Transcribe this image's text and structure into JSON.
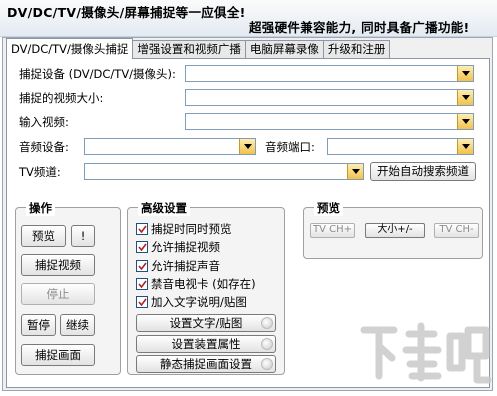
{
  "banner": {
    "line1": "DV/DC/TV/摄像头/屏幕捕捉等一应俱全!",
    "line2": "超强硬件兼容能力, 同时具备广播功能!"
  },
  "tabs": [
    {
      "label": "DV/DC/TV/摄像头捕捉"
    },
    {
      "label": "增强设置和视频广播"
    },
    {
      "label": "电脑屏幕录像"
    },
    {
      "label": "升级和注册"
    }
  ],
  "form": {
    "capture_device_label": "捕捉设备 (DV/DC/TV/摄像头):",
    "video_size_label": "捕捉的视频大小:",
    "input_video_label": "输入视频:",
    "audio_device_label": "音频设备:",
    "audio_port_label": "音频端口:",
    "tv_channel_label": "TV频道:",
    "auto_search_button": "开始自动搜索频道"
  },
  "ops": {
    "title": "操作",
    "preview_button": "预览",
    "preview_extra_button": "!",
    "capture_video_button": "捕捉视频",
    "stop_button": "停止",
    "pause_button": "暂停",
    "continue_button": "继续",
    "capture_frame_button": "捕捉画面"
  },
  "advanced": {
    "title": "高级设置",
    "checkboxes": [
      {
        "label": "捕捉时同时预览",
        "checked": true
      },
      {
        "label": "允许捕捉视频",
        "checked": true
      },
      {
        "label": "允许捕捉声音",
        "checked": true
      },
      {
        "label": "禁音电视卡 (如存在)",
        "checked": true
      },
      {
        "label": "加入文字说明/贴图",
        "checked": true
      }
    ],
    "set_text_button": "设置文字/贴图",
    "set_device_button": "设置装置属性",
    "static_capture_button": "静态捕捉画面设置"
  },
  "preview": {
    "title": "预览",
    "tv_ch_plus": "TV CH+",
    "size_button": "大小+/-",
    "tv_ch_minus": "TV CH-"
  },
  "watermark": {
    "text": "下载吧"
  },
  "colors": {
    "accent_check": "#1c5180",
    "combo_arrow": "#f3c24a",
    "watermark": "#c9c9c9"
  }
}
